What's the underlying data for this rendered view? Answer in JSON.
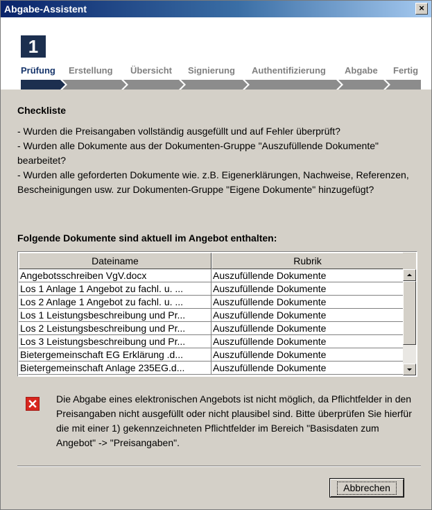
{
  "window": {
    "title": "Abgabe-Assistent",
    "close_label": "×"
  },
  "wizard": {
    "step_number": "1",
    "steps": [
      {
        "label": "Prüfung",
        "active": true
      },
      {
        "label": "Erstellung",
        "active": false
      },
      {
        "label": "Übersicht",
        "active": false
      },
      {
        "label": "Signierung",
        "active": false
      },
      {
        "label": "Authentifizierung",
        "active": false
      },
      {
        "label": "Abgabe",
        "active": false
      },
      {
        "label": "Fertig",
        "active": false
      }
    ]
  },
  "checklist": {
    "title": "Checkliste",
    "items": [
      "- Wurden die Preisangaben vollständig ausgefüllt und auf Fehler überprüft?",
      "- Wurden alle Dokumente aus der Dokumenten-Gruppe \"Auszufüllende Dokumente\" bearbeitet?",
      "- Wurden alle geforderten Dokumente wie. z.B. Eigenerklärungen, Nachweise, Referenzen, Bescheinigungen usw. zur Dokumenten-Gruppe \"Eigene Dokumente\" hinzugefügt?"
    ]
  },
  "documents": {
    "title": "Folgende Dokumente sind aktuell im Angebot enthalten:",
    "columns": [
      "Dateiname",
      "Rubrik"
    ],
    "rows": [
      [
        "Angebotsschreiben VgV.docx",
        "Auszufüllende Dokumente"
      ],
      [
        "Los 1 Anlage 1 Angebot zu fachl. u. ...",
        "Auszufüllende Dokumente"
      ],
      [
        "Los 2 Anlage 1 Angebot zu fachl. u. ...",
        "Auszufüllende Dokumente"
      ],
      [
        "Los 1 Leistungsbeschreibung und Pr...",
        "Auszufüllende Dokumente"
      ],
      [
        "Los 2 Leistungsbeschreibung und Pr...",
        "Auszufüllende Dokumente"
      ],
      [
        "Los 3 Leistungsbeschreibung und Pr...",
        "Auszufüllende Dokumente"
      ],
      [
        "Bietergemeinschaft EG Erklärung .d...",
        "Auszufüllende Dokumente"
      ],
      [
        "Bietergemeinschaft Anlage 235EG.d...",
        "Auszufüllende Dokumente"
      ]
    ]
  },
  "error": {
    "message": "Die Abgabe eines elektronischen Angebots ist nicht möglich, da Pflichtfelder in den Preisangaben nicht ausgefüllt oder nicht plausibel sind. Bitte überprüfen Sie hierfür die mit einer 1) gekennzeichneten Pflichtfelder im Bereich \"Basisdaten zum Angebot\" -> \"Preisangaben\"."
  },
  "buttons": {
    "cancel": "Abbrechen"
  },
  "colors": {
    "title_bar": "#0a246a",
    "step_active": "#17356b",
    "progress_active": "#1c2f4f",
    "progress_inactive": "#8c8c8c",
    "error_icon": "#d7261e"
  }
}
